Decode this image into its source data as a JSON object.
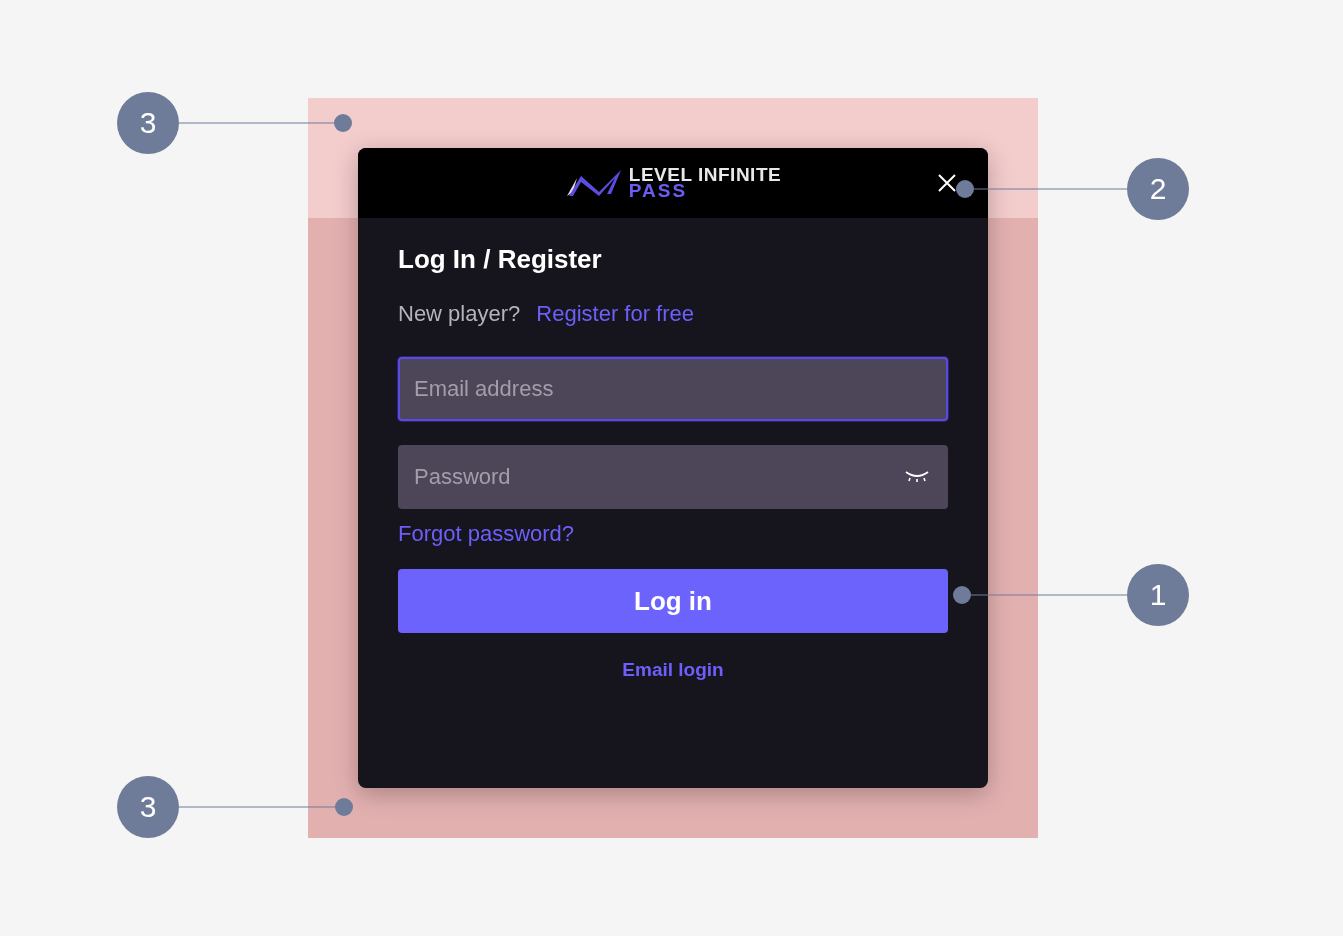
{
  "logo": {
    "line_1": "LEVEL INFINITE",
    "line_2": "PASS"
  },
  "dialog": {
    "title": "Log In / Register",
    "prompt": "New player?",
    "register_link": "Register for free",
    "fields": [
      {
        "kind": "email",
        "placeholder": "Email address",
        "focused": true
      },
      {
        "kind": "password",
        "placeholder": "Password",
        "focused": false
      }
    ],
    "forgot_link": "Forgot password?",
    "login_button": "Log in",
    "alt_link": "Email login"
  },
  "annotations": [
    {
      "label": "3"
    },
    {
      "label": "2"
    },
    {
      "label": "1"
    },
    {
      "label": "3"
    }
  ]
}
